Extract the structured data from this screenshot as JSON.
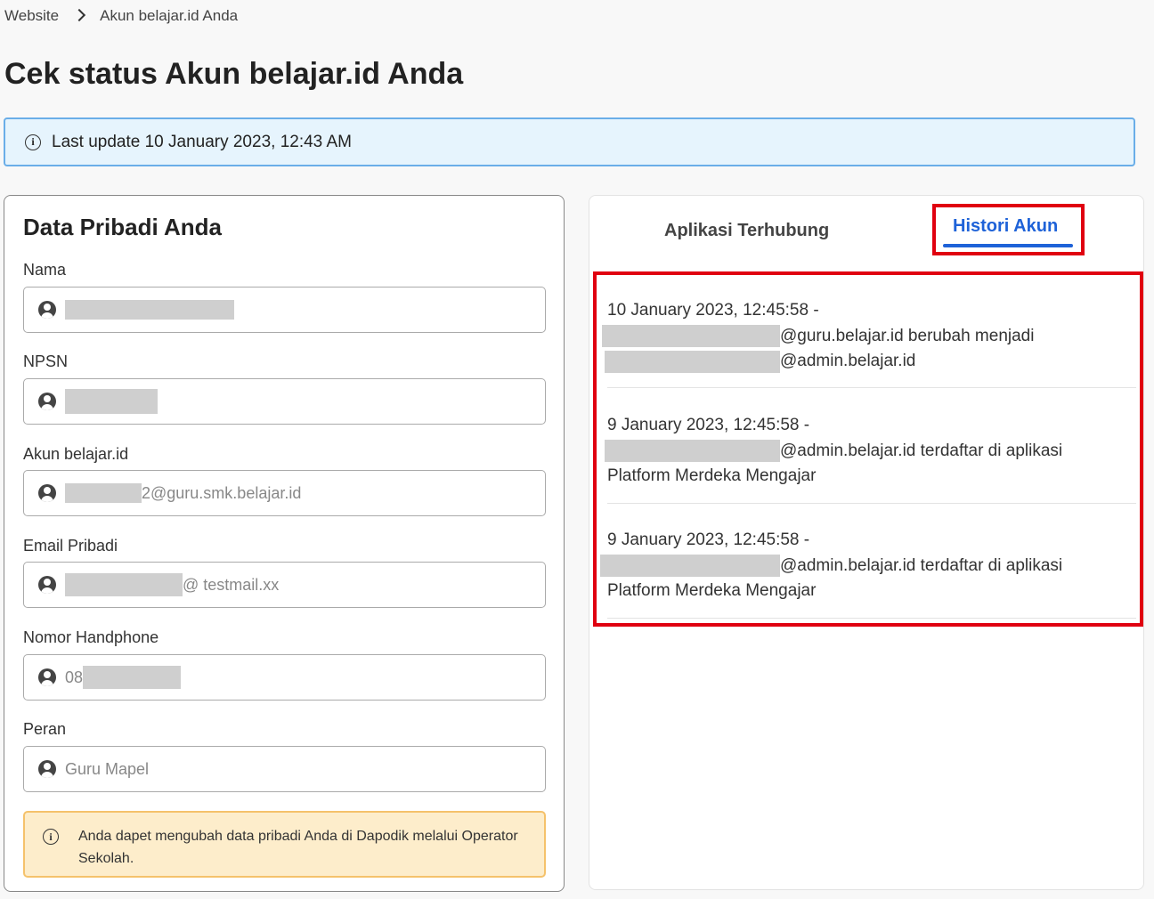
{
  "breadcrumb": {
    "items": [
      "Website",
      "Akun belajar.id Anda"
    ]
  },
  "page": {
    "title": "Cek status Akun belajar.id Anda"
  },
  "banner": {
    "text": "Last update 10 January 2023, 12:43 AM"
  },
  "personal": {
    "title": "Data Pribadi Anda",
    "fields": [
      {
        "label": "Nama",
        "value": ""
      },
      {
        "label": "NPSN",
        "value": ""
      },
      {
        "label": "Akun belajar.id",
        "value": "2@guru.smk.belajar.id"
      },
      {
        "label": "Email Pribadi",
        "value": "@ testmail.xx"
      },
      {
        "label": "Nomor Handphone",
        "value": "08"
      },
      {
        "label": "Peran",
        "value": "Guru Mapel"
      }
    ],
    "notice": "Anda dapet mengubah data pribadi Anda di Dapodik melalui Operator Sekolah."
  },
  "tabs": {
    "aplikasi": "Aplikasi Terhubung",
    "histori": "Histori Akun",
    "active": "Histori Akun"
  },
  "history": [
    {
      "line1": "10 January 2023, 12:45:58 -",
      "line2": "@guru.belajar.id berubah menjadi",
      "line3": "@admin.belajar.id"
    },
    {
      "line1": "9 January 2023, 12:45:58 -",
      "line2": "@admin.belajar.id terdaftar di aplikasi",
      "line3": "Platform Merdeka Mengajar"
    },
    {
      "line1": "9 January 2023, 12:45:58 -",
      "line2": "@admin.belajar.id terdaftar di aplikasi",
      "line3": "Platform Merdeka Mengajar"
    }
  ],
  "colors": {
    "accent": "#1e62d8",
    "highlight": "#e00010",
    "banner_bg": "#e6f4fd",
    "notice_bg": "#fdedcb"
  },
  "icons": {
    "field": "user-icon",
    "info": "info-icon",
    "breadcrumb_sep": "chevron-right-icon"
  }
}
